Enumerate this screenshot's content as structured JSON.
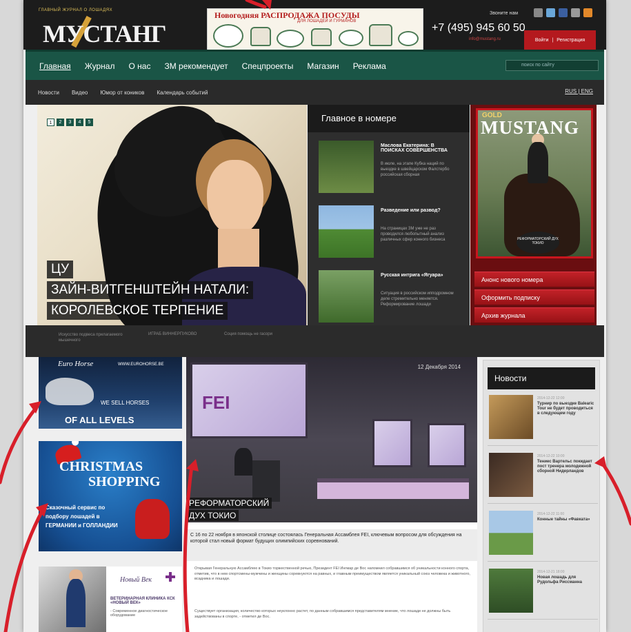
{
  "header": {
    "logo_tagline": "ГЛАВНЫЙ ЖУРНАЛ О ЛОШАДЯХ",
    "logo_text": "МУСТАНГ",
    "banner_title": "Новогодняя РАСПРОДАЖА ПОСУДЫ",
    "banner_sub": "ДЛЯ ЛОШАДЕЙ И ГУРМАНОВ",
    "call_us": "Звоните нам",
    "phone": "+7 (495) 945 60 50",
    "email": "info@mustang.ru",
    "login": "Войти",
    "register": "Регистрация"
  },
  "nav": {
    "items": [
      "Главная",
      "Журнал",
      "О нас",
      "ЗМ рекомендует",
      "Спецпроекты",
      "Магазин",
      "Реклама"
    ],
    "search_placeholder": "поиск по сайту"
  },
  "subnav": {
    "items": [
      "Новости",
      "Видео",
      "Юмор от коников",
      "Календарь событий"
    ],
    "lang": "RUS | ENG"
  },
  "hero": {
    "pager": [
      "1",
      "2",
      "3",
      "4",
      "5"
    ],
    "caption1": "ЦУ",
    "caption2": "ЗАЙН-ВИТГЕНШТЕЙН НАТАЛИ:",
    "caption3": "КОРОЛЕВСКОЕ ТЕРПЕНИЕ"
  },
  "issue": {
    "title": "Главное в номере",
    "items": [
      {
        "title": "Маслова Екатерина: В ПОИСКАХ СОВЕРШЕНСТВА",
        "text": "В июле, на этапе Кубка наций по выездке в швейцарском Фалстербо российская сборная"
      },
      {
        "title": "Разведение или развод?",
        "text": "На страницах ЗМ уже не раз проводился любопытный анализ различных сфер конного бизнеса"
      },
      {
        "title": "Русская интрига «Ягуара»",
        "text": "Ситуация в российском ипподромном деле стремительно меняется. Реформирование лошади"
      }
    ]
  },
  "magazine": {
    "cover_gold": "GOLD",
    "cover_title": "MUSTANG",
    "cover_badge": "РЕФОРМАТОРСКИЙ ДУХ ТОКИО",
    "buttons": [
      "Анонс нового номера",
      "Оформить подписку",
      "Архив журнала"
    ]
  },
  "strip": {
    "items": [
      "Искусство подвеса прилагаемого мышечного",
      "ИГРАБ ВИННЕРПУКОВО",
      "Соция помощь не гасори"
    ]
  },
  "ads": {
    "euro_brand": "Euro Horse",
    "euro_url": "WWW.EUROHORSE.BE",
    "euro_we": "WE SELL HORSES",
    "euro_levels": "OF ALL LEVELS",
    "xmas_line1": "CHRISTMAS",
    "xmas_line2": "SHOPPING",
    "xmas_body": "Сказочный сервис по подбору лошадей в ГЕРМАНИИ и ГОЛЛАНДИИ",
    "vet_script": "Новый Век",
    "vet_title": "ВЕТЕРИНАРНАЯ КЛИНИКА КСК «НОВЫЙ ВЕК»",
    "vet_text": "- Современное диагностическое оборудование"
  },
  "article": {
    "date": "12 Декабря 2014",
    "screen_label": "FEI",
    "caption1": "РЕФОРМАТОРСКИЙ",
    "caption2": "ДУХ ТОКИО",
    "lead": "С 16 по 22 ноября в японской столице состоялась Генеральная Ассамблея FEI, ключевым вопросом для обсуждения на которой стал новый формат будущих олимпийских соревнований.",
    "para1": "Открывая Генеральную Ассамблею в Токио торжественной речью, Президент FEI Ингмар де Вос напомнил собравшимся об уникальности конного спорта, отметив, что в нем спортсмены-мужчины и женщины соревнуются на равных, и главным преимуществом является уникальный союз человека и животного, всадника и лошади.",
    "para2": "Существует организация, количество которых неуклонно растет, по данным собравшимся представителям мнение, что лошади не должны быть задействованы в спорте, - отметил де Вос."
  },
  "news": {
    "title": "Новости",
    "items": [
      {
        "ts": "2014-12-22 12:00",
        "title": "Турнир по выездке Balearic Tour не будет проводиться в следующем году"
      },
      {
        "ts": "2014-12-22 10:00",
        "title": "Тениес Вартельс покидает пост тренера молодежной сборной Нидерландов"
      },
      {
        "ts": "2014-12-22 11:00",
        "title": "Конные тайны «Фавката»"
      },
      {
        "ts": "2014-12-21 18:00",
        "title": "Новая лошадь для Рудольфа Риссманна"
      }
    ]
  },
  "colors": {
    "nav_green": "#1a5546",
    "accent_red": "#b4191e",
    "annotation_arrow": "#d81f2a"
  }
}
